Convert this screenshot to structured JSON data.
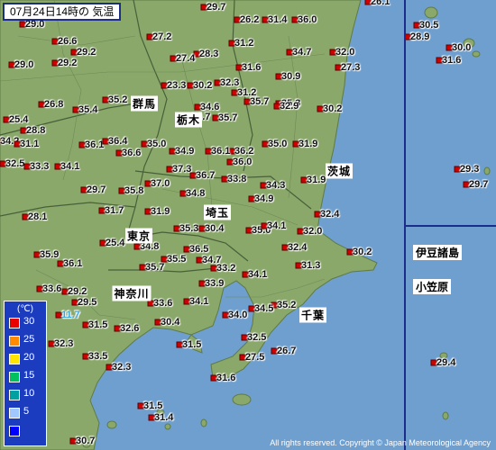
{
  "title": "07月24日14時の 気温",
  "legend": {
    "unit": "(℃)",
    "levels": [
      {
        "value": "30",
        "color": "#e80000"
      },
      {
        "value": "25",
        "color": "#ff8c00"
      },
      {
        "value": "20",
        "color": "#ffe400"
      },
      {
        "value": "15",
        "color": "#00c060"
      },
      {
        "value": "10",
        "color": "#00a0a0"
      },
      {
        "value": "5",
        "color": "#a0c8ff"
      },
      {
        "value": "",
        "color": "#0000ff"
      }
    ]
  },
  "prefectures": [
    "群馬",
    "栃木",
    "茨城",
    "埼玉",
    "東京",
    "神奈川",
    "千葉"
  ],
  "island_groups": [
    "伊豆諸島",
    "小笠原"
  ],
  "copyright": "All rights reserved. Copyright © Japan Meteorological Agency",
  "colors": {
    "sea": "#6f9fcf",
    "land": "#8aa86a",
    "border": "#1b2c8a",
    "marker": "#d00000"
  },
  "temperatures": [
    "29.7",
    "26.2",
    "31.4",
    "36.0",
    "26.1",
    "29.0",
    "27.2",
    "31.2",
    "34.7",
    "32.0",
    "30.5",
    "28.9",
    "26.6",
    "29.2",
    "28.3",
    "27.4",
    "31.6",
    "29.2",
    "27.3",
    "30.0",
    "29.0",
    "31.2",
    "30.9",
    "23.3",
    "30.2",
    "32.3",
    "35.3",
    "31.6",
    "26.8",
    "35.2",
    "35.4",
    "34.6",
    "35.7",
    "32.9",
    "30.2",
    "25.4",
    "35.7",
    "34.7",
    "28.8",
    "36.2",
    "36.1",
    "34.2",
    "31.1",
    "36.4",
    "35.0",
    "34.9",
    "36.1",
    "35.0",
    "31.9",
    "36.6",
    "36.0",
    "32.5",
    "33.3",
    "34.1",
    "37.3",
    "36.7",
    "33.8",
    "31.9",
    "29.3",
    "29.7",
    "34.3",
    "29.7",
    "35.8",
    "37.0",
    "34.8",
    "34.9",
    "31.7",
    "31.9",
    "32.4",
    "28.1",
    "35.3",
    "30.4",
    "35.0",
    "34.1",
    "32.0",
    "25.4",
    "34.8",
    "36.5",
    "32.4",
    "30.2",
    "35.9",
    "36.1",
    "35.7",
    "35.5",
    "34.7",
    "33.2",
    "34.1",
    "31.3",
    "33.6",
    "29.2",
    "33.9",
    "29.5",
    "35.2",
    "11.7",
    "33.6",
    "34.1",
    "34.0",
    "34.5",
    "31.5",
    "30.4",
    "32.6",
    "32.3",
    "31.5",
    "32.5",
    "33.5",
    "27.5",
    "26.7",
    "32.3",
    "29.4",
    "31.6",
    "31.5",
    "31.4",
    "30.7"
  ]
}
